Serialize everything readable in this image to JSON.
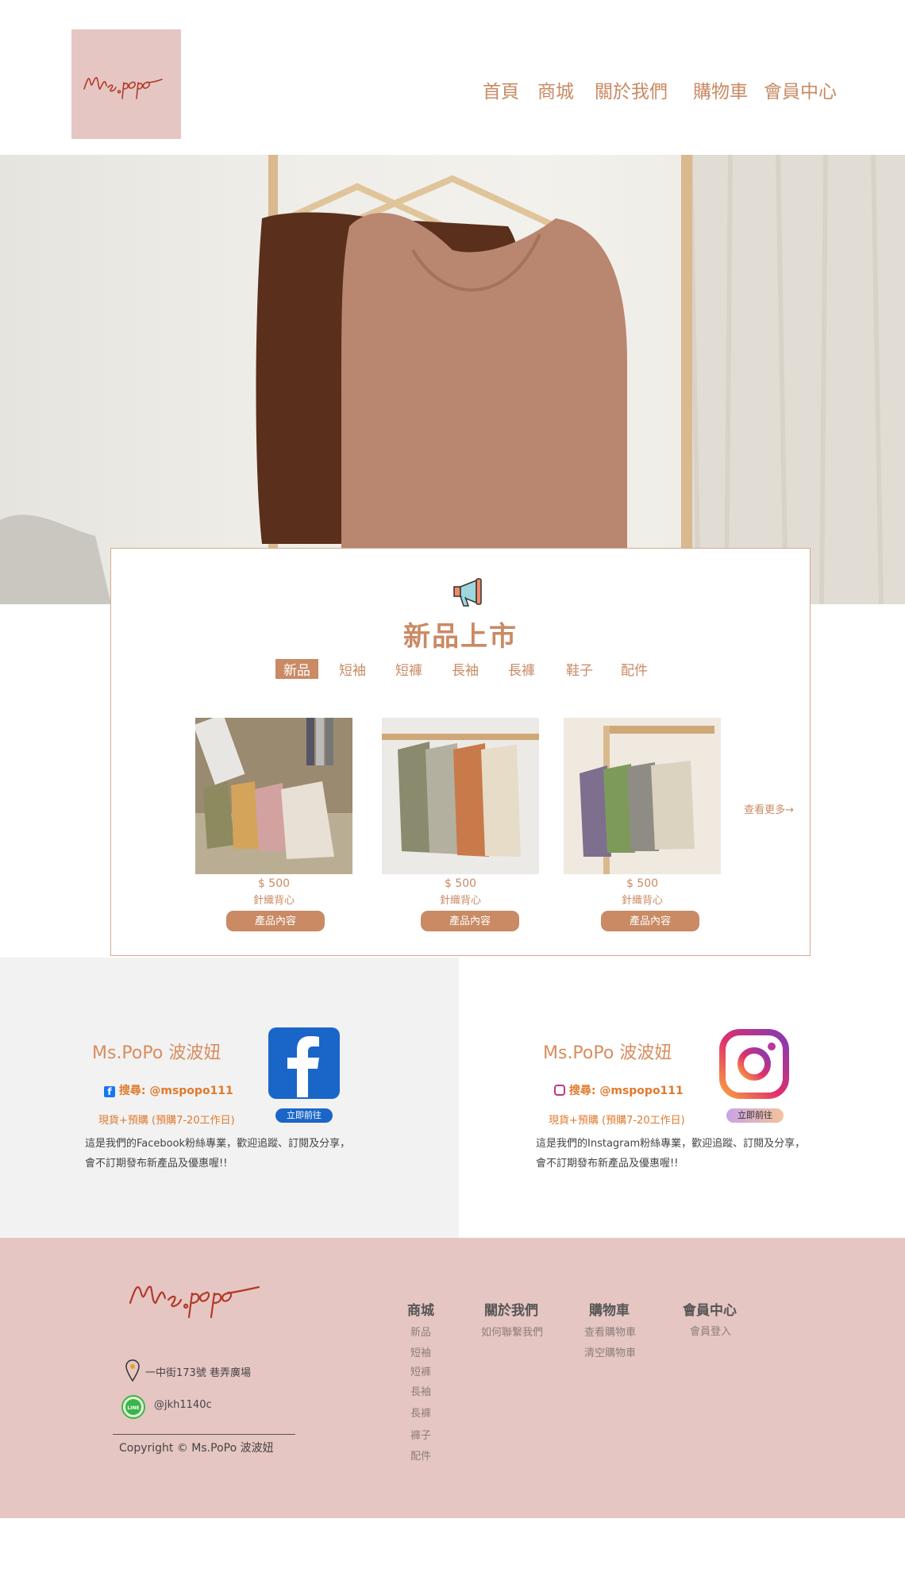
{
  "brand": {
    "logo_text": "Ms.popo",
    "name": "Ms.PoPo 波波妞"
  },
  "nav": {
    "home": "首頁",
    "shop": "商城",
    "about": "關於我們",
    "cart": "購物車",
    "member": "會員中心"
  },
  "new_arrivals": {
    "icon": "megaphone-icon",
    "title": "新品上市",
    "tabs": [
      "新品",
      "短袖",
      "短褲",
      "長袖",
      "長褲",
      "鞋子",
      "配件"
    ],
    "active_tab": "新品",
    "products": [
      {
        "price": "$ 500",
        "name": "針織背心",
        "button": "產品內容"
      },
      {
        "price": "$ 500",
        "name": "針織背心",
        "button": "產品內容"
      },
      {
        "price": "$ 500",
        "name": "針織背心",
        "button": "產品內容"
      }
    ],
    "more": "查看更多→"
  },
  "social": {
    "facebook": {
      "title": "Ms.PoPo 波波妞",
      "search_label": "搜尋:",
      "handle": "@mspopo111",
      "preorder": "現貨+預購 (預購7-20工作日)",
      "desc_line1": "這是我們的Facebook粉絲專業，歡迎追蹤、訂閱及分享，",
      "desc_line2": "會不訂期發布新產品及優惠喔!!",
      "button": "立即前往",
      "icon": "facebook-icon",
      "color": "#1877f2"
    },
    "instagram": {
      "title": "Ms.PoPo 波波妞",
      "search_label": "搜尋:",
      "handle": "@mspopo111",
      "preorder": "現貨+預購 (預購7-20工作日)",
      "desc_line1": "這是我們的Instagram粉絲專業，歡迎追蹤、訂閱及分享，",
      "desc_line2": "會不訂期發布新產品及優惠喔!!",
      "button": "立即前往",
      "icon": "instagram-icon"
    }
  },
  "footer": {
    "address": "一中街173號 巷弄廣場",
    "line_id": "@jkh1140c",
    "copyright": "Copyright © Ms.PoPo 波波妞",
    "columns": {
      "shop": {
        "heading": "商城",
        "links": [
          "新品",
          "短袖",
          "短褲",
          "長袖",
          "長褲",
          "褲子",
          "配件"
        ]
      },
      "about": {
        "heading": "關於我們",
        "links": [
          "如何聯繫我們"
        ]
      },
      "cart": {
        "heading": "購物車",
        "links": [
          "查看購物車",
          "清空購物車"
        ]
      },
      "member": {
        "heading": "會員中心",
        "links": [
          "會員登入"
        ]
      }
    }
  },
  "colors": {
    "accent": "#c98a64",
    "pink_bg": "#e6c6c2",
    "logo_red": "#b23a2a"
  }
}
